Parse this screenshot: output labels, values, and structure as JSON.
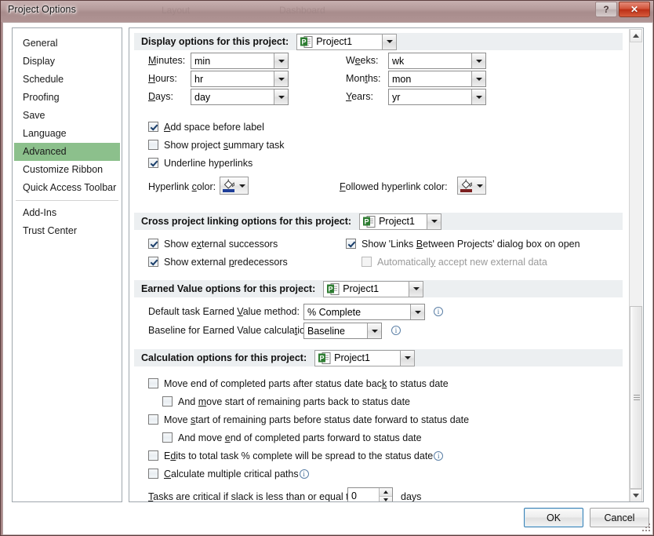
{
  "window": {
    "title": "Project Options",
    "ghost_labels": [
      "Layout",
      "Dashboard"
    ],
    "help_button": "?",
    "close_button": "✕"
  },
  "sidebar": {
    "items": [
      {
        "label": "General",
        "selected": false
      },
      {
        "label": "Display",
        "selected": false
      },
      {
        "label": "Schedule",
        "selected": false
      },
      {
        "label": "Proofing",
        "selected": false
      },
      {
        "label": "Save",
        "selected": false
      },
      {
        "label": "Language",
        "selected": false
      },
      {
        "label": "Advanced",
        "selected": true
      },
      {
        "label": "Customize Ribbon",
        "selected": false
      },
      {
        "label": "Quick Access Toolbar",
        "selected": false
      },
      {
        "label": "Add-Ins",
        "selected": false
      },
      {
        "label": "Trust Center",
        "selected": false
      }
    ]
  },
  "display_options": {
    "header": "Display options for this project:",
    "project": "Project1",
    "fields": [
      {
        "label": "Minutes:",
        "accel": "M",
        "value": "min"
      },
      {
        "label": "Hours:",
        "accel": "H",
        "value": "hr"
      },
      {
        "label": "Days:",
        "accel": "D",
        "value": "day"
      },
      {
        "label": "Weeks:",
        "accel": "e",
        "value": "wk"
      },
      {
        "label": "Months:",
        "accel": "t",
        "value": "mon"
      },
      {
        "label": "Years:",
        "accel": "Y",
        "value": "yr"
      }
    ],
    "checkboxes": [
      {
        "label": "Add space before label",
        "checked": true,
        "disabled": false
      },
      {
        "label": "Show project summary task",
        "checked": false,
        "disabled": false
      },
      {
        "label": "Underline hyperlinks",
        "checked": true,
        "disabled": false
      }
    ],
    "hyperlink_color_label": "Hyperlink color:",
    "hyperlink_color": "#1f3f99",
    "followed_hyperlink_color_label": "Followed hyperlink color:",
    "followed_hyperlink_color": "#7b1f1f"
  },
  "cross_project": {
    "header": "Cross project linking options for this project:",
    "project": "Project1",
    "checkboxes": [
      {
        "label": "Show external successors",
        "checked": true,
        "disabled": false
      },
      {
        "label": "Show external predecessors",
        "checked": true,
        "disabled": false
      },
      {
        "label": "Show 'Links Between Projects' dialog box on open",
        "checked": true,
        "disabled": false
      },
      {
        "label": "Automatically accept new external data",
        "checked": false,
        "disabled": true
      }
    ]
  },
  "earned_value": {
    "header": "Earned Value options for this project:",
    "project": "Project1",
    "method_label": "Default task Earned Value method:",
    "method_value": "% Complete",
    "baseline_label": "Baseline for Earned Value calculation:",
    "baseline_value": "Baseline",
    "info_glyph": "i"
  },
  "calculation": {
    "header": "Calculation options for this project:",
    "project": "Project1",
    "checkboxes": [
      {
        "label": "Move end of completed parts after status date back to status date",
        "checked": false,
        "indent": false,
        "info": false
      },
      {
        "label": "And move start of remaining parts back to status date",
        "checked": false,
        "indent": true,
        "info": false
      },
      {
        "label": "Move start of remaining parts before status date forward to status date",
        "checked": false,
        "indent": false,
        "info": false
      },
      {
        "label": "And move end of completed parts forward to status date",
        "checked": false,
        "indent": true,
        "info": false
      },
      {
        "label": "Edits to total task % complete will be spread to the status date",
        "checked": false,
        "indent": false,
        "info": true
      },
      {
        "label": "Calculate multiple critical paths",
        "checked": false,
        "indent": false,
        "info": true
      }
    ],
    "slack_label": "Tasks are critical if slack is less than or equal to",
    "slack_value": "0",
    "slack_units": "days"
  },
  "footer": {
    "ok_label": "OK",
    "cancel_label": "Cancel"
  },
  "colors": {
    "selection_green": "#8cc08c",
    "title_bar": "#a88c8c",
    "section_band": "#eceff1",
    "close_red": "#bc2f16"
  }
}
